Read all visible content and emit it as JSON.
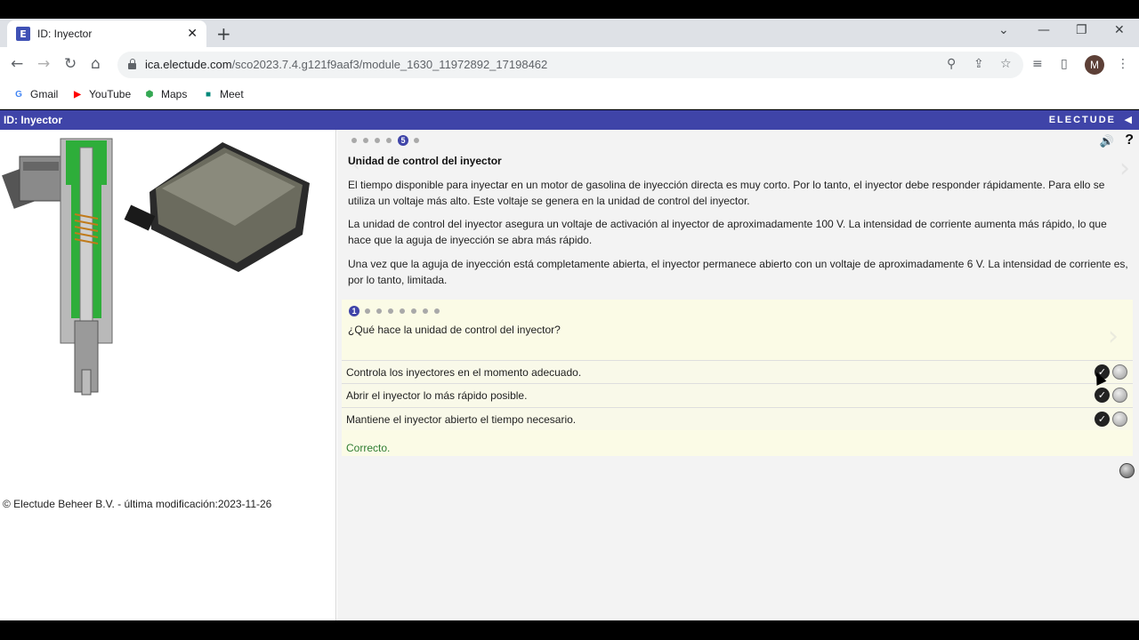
{
  "browser": {
    "tab_title": "ID: Inyector",
    "tab_favicon": "E",
    "new_tab": "+",
    "url_host": "ica.electude.com",
    "url_path": "/sco2023.7.4.g121f9aaf3/module_1630_11972892_17198462",
    "profile_initial": "M",
    "bookmarks": [
      {
        "label": "Gmail",
        "icon": "gmail-icon",
        "glyph": "G",
        "color": "#4285f4"
      },
      {
        "label": "YouTube",
        "icon": "youtube-icon",
        "glyph": "▶",
        "color": "#ff0000"
      },
      {
        "label": "Maps",
        "icon": "maps-icon",
        "glyph": "⬢",
        "color": "#34a853"
      },
      {
        "label": "Meet",
        "icon": "meet-icon",
        "glyph": "■",
        "color": "#00897b"
      }
    ]
  },
  "app": {
    "title": "ID: Inyector",
    "brand": "ELECTUDE",
    "accent_color": "#3f44a8",
    "footer": "© Electude Beheer B.V. - última modificación:2023-11-26"
  },
  "lesson": {
    "page_dots_total": 6,
    "page_current": "5",
    "section_title": "Unidad de control del inyector",
    "paragraphs": [
      "El tiempo disponible para inyectar en un motor de gasolina de inyección directa es muy corto. Por lo tanto, el inyector debe responder rápidamente. Para ello se utiliza un voltaje más alto. Este voltaje se genera en la unidad de control del inyector.",
      "La unidad de control del inyector asegura un voltaje de activación al inyector de aproximadamente 100 V. La intensidad de corriente aumenta más rápido, lo que hace que la aguja de inyección se abra más rápido.",
      "Una vez que la aguja de inyección está completamente abierta, el inyector permanece abierto con un voltaje de aproximadamente 6 V. La intensidad de corriente es, por lo tanto, limitada."
    ]
  },
  "quiz": {
    "question_current": "1",
    "question_dots_total": 8,
    "question": "¿Qué hace la unidad de control del inyector?",
    "answers": [
      {
        "text": "Controla los inyectores en el momento adecuado."
      },
      {
        "text": "Abrir el inyector lo más rápido posible."
      },
      {
        "text": "Mantiene el inyector abierto el tiempo necesario."
      }
    ],
    "feedback": "Correcto.",
    "feedback_color": "#2e7d32"
  }
}
